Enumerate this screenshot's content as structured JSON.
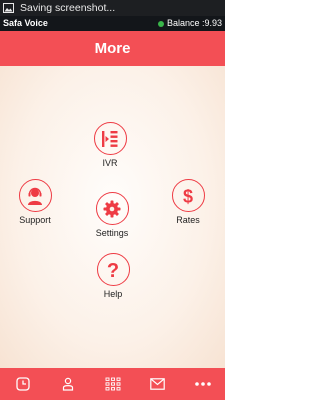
{
  "status_bar": {
    "notification_text": "Saving screenshot..."
  },
  "app_bar": {
    "app_name": "Safa Voice",
    "balance_text": "Balance :9.93",
    "balance_color": "#39b54a"
  },
  "header": {
    "title": "More"
  },
  "menu": {
    "ivr": {
      "label": "IVR",
      "icon": "ivr-icon"
    },
    "support": {
      "label": "Support",
      "icon": "support-agent-icon"
    },
    "settings": {
      "label": "Settings",
      "icon": "gear-icon"
    },
    "rates": {
      "label": "Rates",
      "icon": "dollar-icon"
    },
    "help": {
      "label": "Help",
      "icon": "question-icon"
    }
  },
  "bottom_nav": [
    "history-icon",
    "contacts-icon",
    "keypad-icon",
    "messages-icon",
    "more-icon"
  ],
  "colors": {
    "accent": "#f34f55",
    "icon": "#ee3b44"
  }
}
